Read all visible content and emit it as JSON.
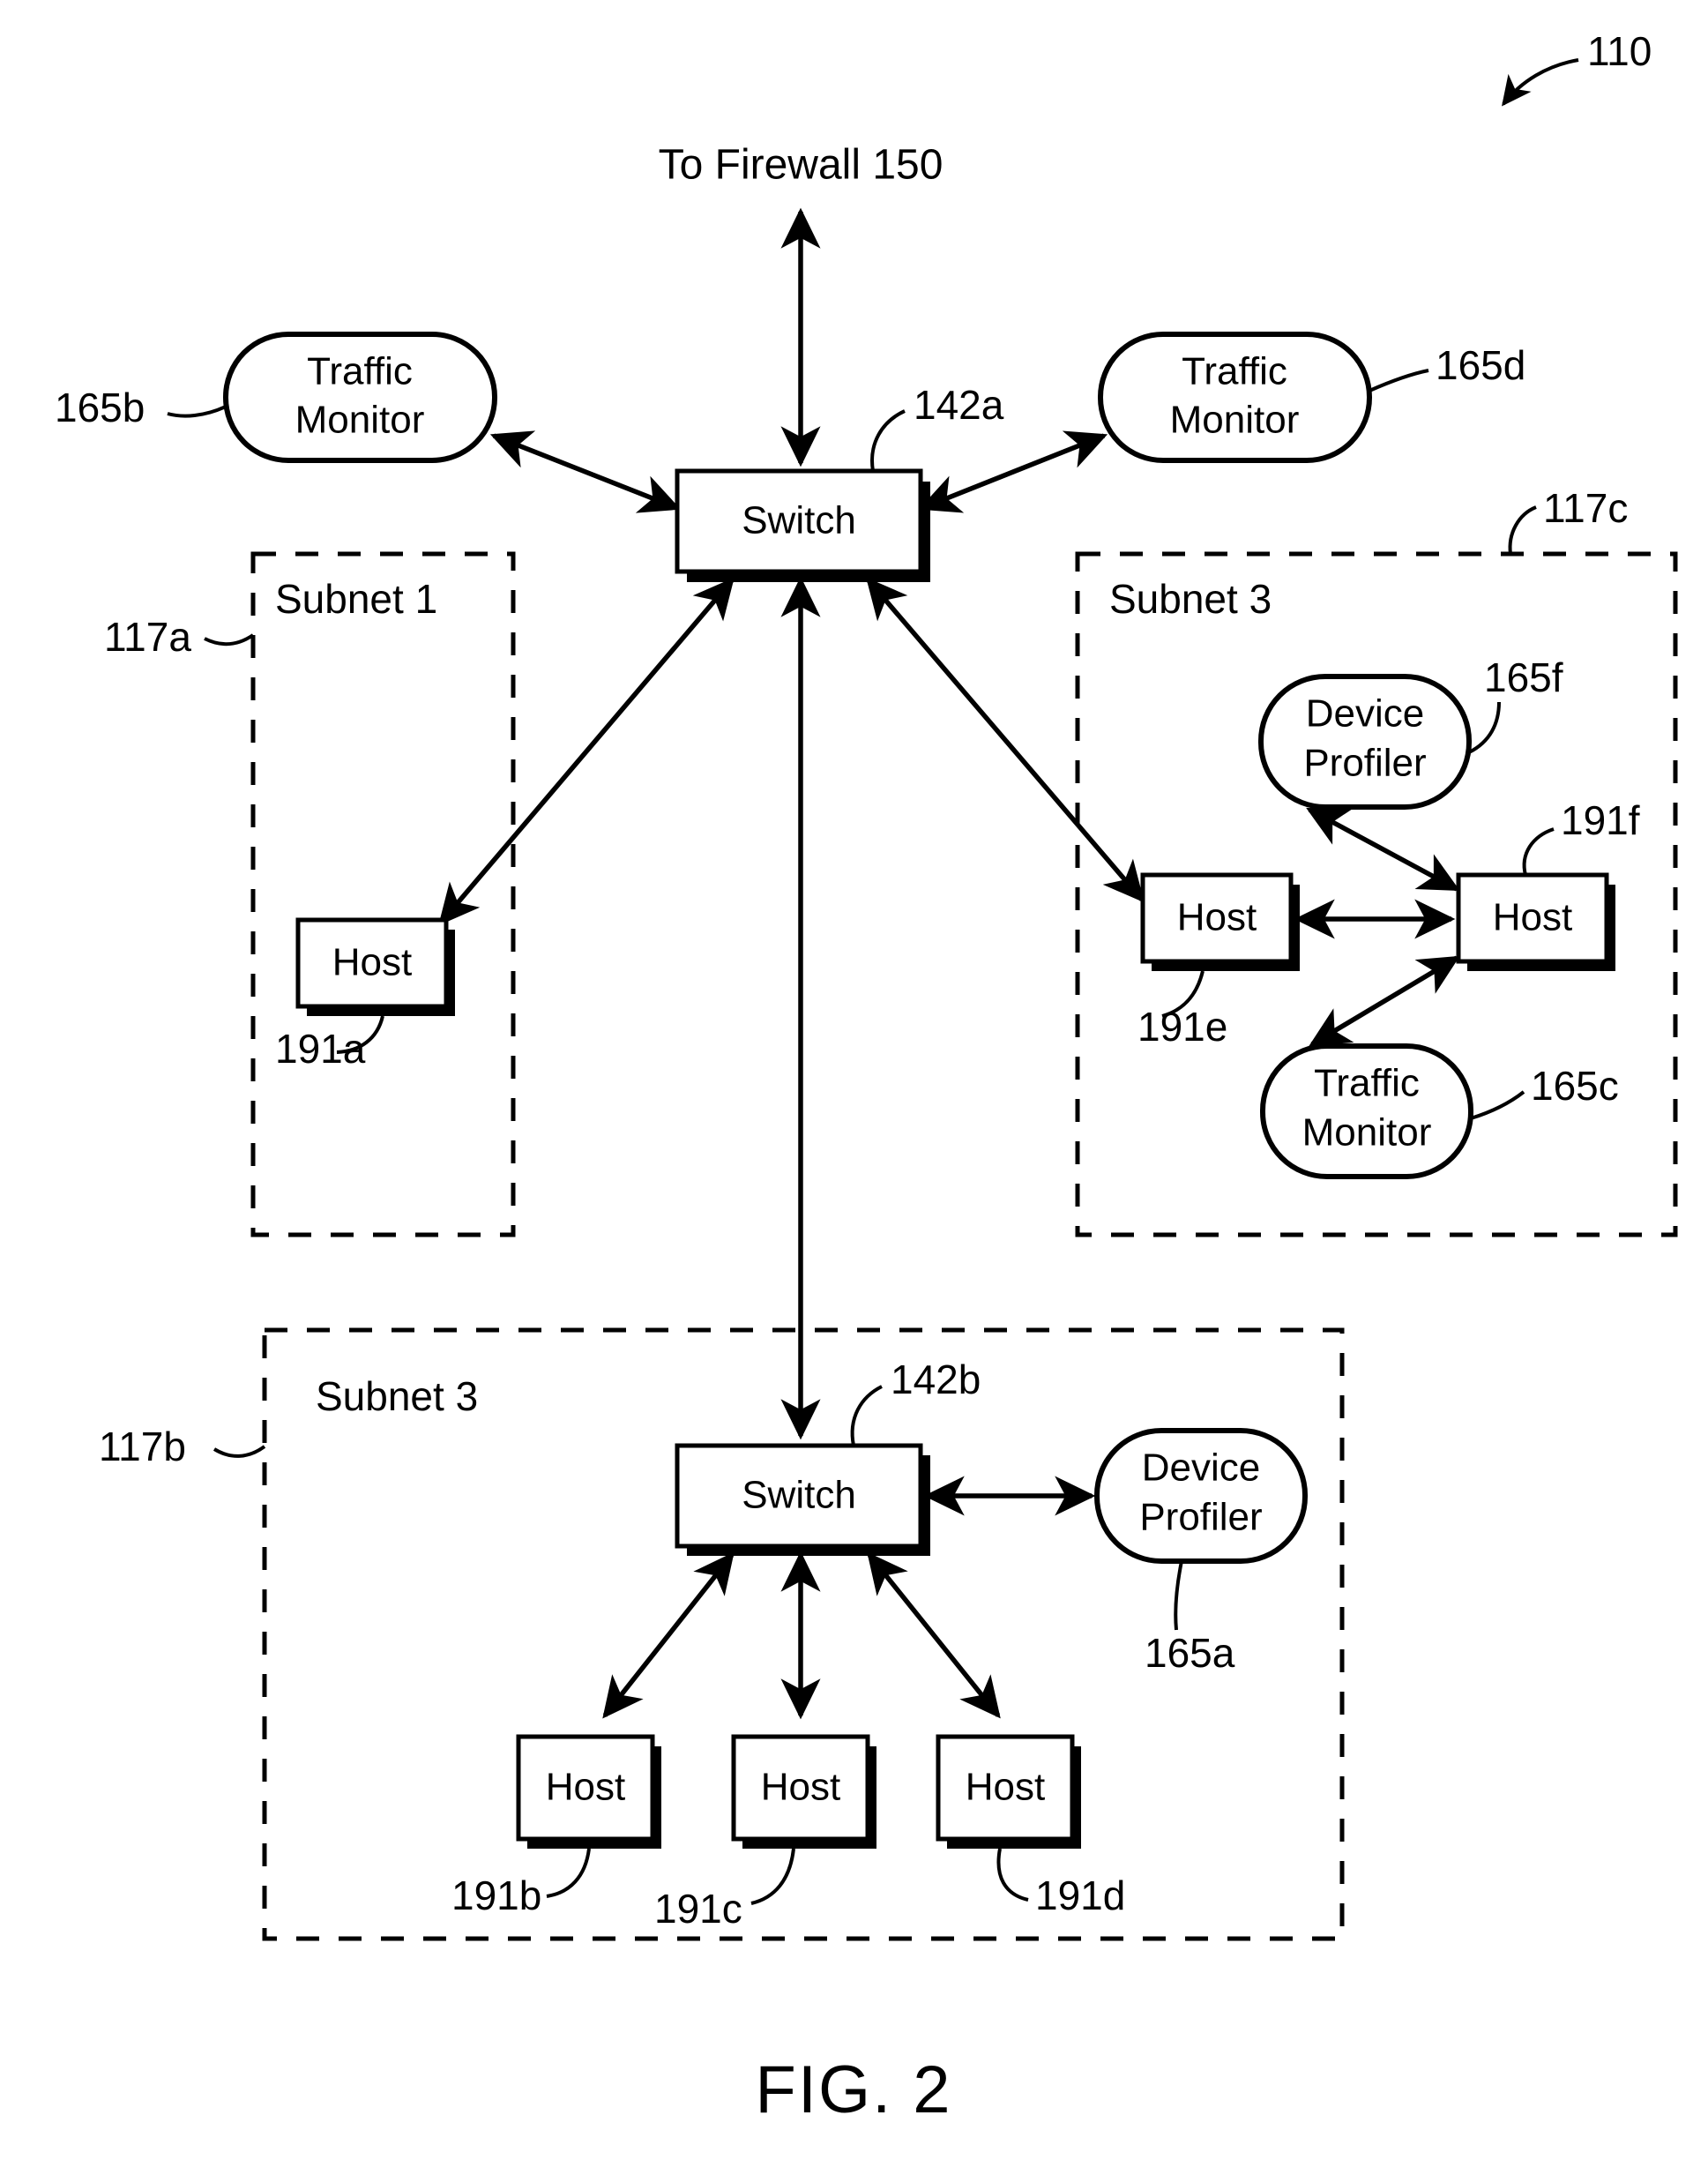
{
  "figure": {
    "caption": "FIG. 2",
    "system_ref": "110",
    "top_link_label": "To Firewall 150"
  },
  "nodes": {
    "switch_a": {
      "label": "Switch",
      "ref": "142a"
    },
    "switch_b": {
      "label": "Switch",
      "ref": "142b"
    },
    "traffic_monitor_b": {
      "label_line1": "Traffic",
      "label_line2": "Monitor",
      "ref": "165b"
    },
    "traffic_monitor_d": {
      "label_line1": "Traffic",
      "label_line2": "Monitor",
      "ref": "165d"
    },
    "traffic_monitor_c": {
      "label_line1": "Traffic",
      "label_line2": "Monitor",
      "ref": "165c"
    },
    "device_profiler_f": {
      "label_line1": "Device",
      "label_line2": "Profiler",
      "ref": "165f"
    },
    "device_profiler_a": {
      "label_line1": "Device",
      "label_line2": "Profiler",
      "ref": "165a"
    },
    "host_a": {
      "label": "Host",
      "ref": "191a"
    },
    "host_b": {
      "label": "Host",
      "ref": "191b"
    },
    "host_c": {
      "label": "Host",
      "ref": "191c"
    },
    "host_d": {
      "label": "Host",
      "ref": "191d"
    },
    "host_e": {
      "label": "Host",
      "ref": "191e"
    },
    "host_f": {
      "label": "Host",
      "ref": "191f"
    }
  },
  "subnets": {
    "left": {
      "title": "Subnet 1",
      "ref": "117a"
    },
    "right": {
      "title": "Subnet 3",
      "ref": "117c"
    },
    "bottom": {
      "title": "Subnet 3",
      "ref": "117b"
    }
  }
}
